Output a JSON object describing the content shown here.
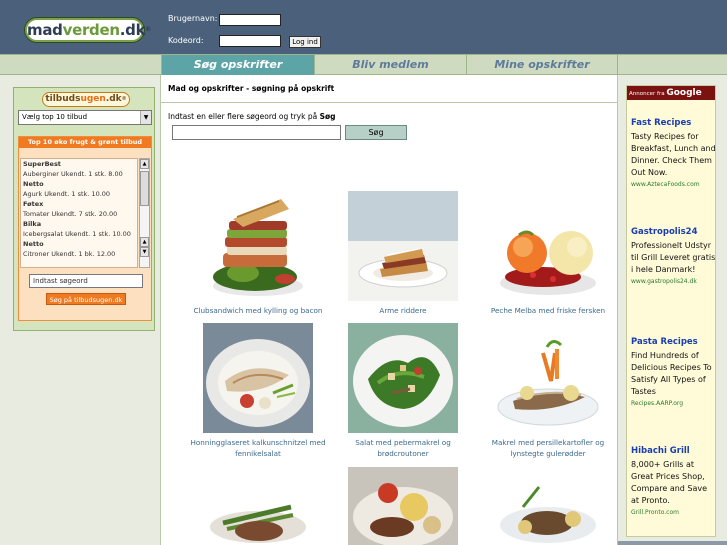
{
  "header": {
    "logo": {
      "mad": "mad",
      "verden": "verden",
      "dk": ".dk",
      "reg": "®"
    },
    "username_label": "Brugernavn:",
    "password_label": "Kodeord:",
    "login_button": "Log ind"
  },
  "nav": {
    "tabs": [
      {
        "label": "Søg opskrifter",
        "active": true
      },
      {
        "label": "Bliv medlem",
        "active": false
      },
      {
        "label": "Mine opskrifter",
        "active": false
      }
    ]
  },
  "sidebar": {
    "logo": {
      "tilbud": "tilbuds",
      "ugen": "ugen",
      "dk": ".dk",
      "reg": "®"
    },
    "select_value": "Vælg top 10 tilbud",
    "panel_title": "Top 10 øko frugt & grønt tilbud",
    "offers": [
      {
        "text": "SuperBest",
        "store": true
      },
      {
        "text": "Auberginer Ukendt. 1 stk. 8.00",
        "store": false
      },
      {
        "text": "Netto",
        "store": true
      },
      {
        "text": "Agurk Ukendt. 1 stk. 10.00",
        "store": false
      },
      {
        "text": "Føtex",
        "store": true
      },
      {
        "text": "Tomater Ukendt. 7 stk. 20.00",
        "store": false
      },
      {
        "text": "Bilka",
        "store": true
      },
      {
        "text": "Icebergsalat Ukendt. 1 stk. 10.00",
        "store": false
      },
      {
        "text": "Netto",
        "store": true
      },
      {
        "text": "Citroner Ukendt. 1 bk. 12.00",
        "store": false
      }
    ],
    "search_value": "Indtast søgeord",
    "search_button": "Søg på tilbudsugen.dk"
  },
  "main": {
    "heading": "Mad og opskrifter - søgning på opskrift",
    "intro_prefix": "Indtast en eller flere søgeord og tryk på",
    "intro_bold": "Søg",
    "search_button": "Søg",
    "recipes": [
      {
        "caption": "Clubsandwich med kylling og bacon"
      },
      {
        "caption": "Arme riddere"
      },
      {
        "caption": "Peche Melba med friske fersken"
      },
      {
        "caption": "Honningglaseret kalkunschnitzel med fennikelsalat"
      },
      {
        "caption": "Salat med pebermakrel og brødcroutoner"
      },
      {
        "caption": "Makrel med persillekartofler og lynstegte gulerødder"
      },
      {
        "caption": ""
      },
      {
        "caption": ""
      },
      {
        "caption": ""
      }
    ]
  },
  "ads": {
    "label_prefix": "Annoncer fra",
    "label_brand": "Google",
    "items": [
      {
        "title": "Fast Recipes",
        "text": "Tasty Recipes for Breakfast, Lunch and Dinner. Check Them Out Now.",
        "url": "www.AztecaFoods.com"
      },
      {
        "title": "Gastropolis24",
        "text": "Professionelt Udstyr til Grill Leveret gratis i hele Danmark!",
        "url": "www.gastropolis24.dk"
      },
      {
        "title": "Pasta Recipes",
        "text": "Find Hundreds of Delicious Recipes To Satisfy All Types of Tastes",
        "url": "Recipes.AARP.org"
      },
      {
        "title": "Hibachi Grill",
        "text": "8,000+ Grills at Great Prices Shop, Compare and Save at Pronto.",
        "url": "Grill.Pronto.com"
      }
    ]
  },
  "colors": {
    "header_bg": "#4b617b",
    "nav_bg": "#cfdbc1",
    "active_tab": "#5ca4a6",
    "orange": "#f07a22",
    "link": "#3c6a8e",
    "ad_title": "#1a3eb0",
    "ad_url": "#2a7a2a"
  }
}
